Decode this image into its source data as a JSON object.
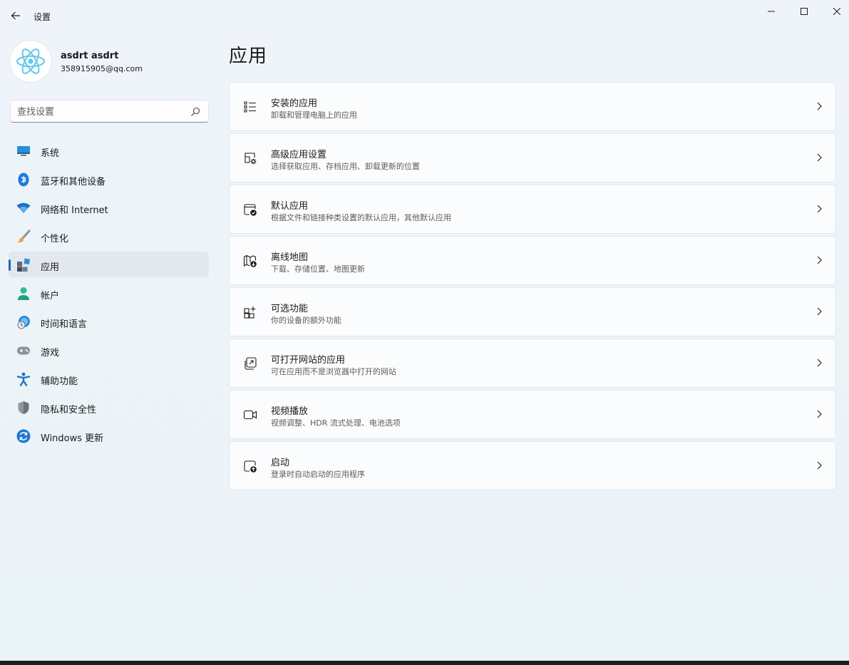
{
  "window": {
    "title": "设置"
  },
  "user": {
    "name": "asdrt asdrt",
    "email": "358915905@qq.com"
  },
  "search": {
    "placeholder": "查找设置"
  },
  "sidebar": {
    "items": [
      {
        "label": "系统",
        "icon": "display-icon",
        "active": false
      },
      {
        "label": "蓝牙和其他设备",
        "icon": "bluetooth-icon",
        "active": false
      },
      {
        "label": "网络和 Internet",
        "icon": "wifi-icon",
        "active": false
      },
      {
        "label": "个性化",
        "icon": "brush-icon",
        "active": false
      },
      {
        "label": "应用",
        "icon": "apps-icon",
        "active": true
      },
      {
        "label": "帐户",
        "icon": "account-icon",
        "active": false
      },
      {
        "label": "时间和语言",
        "icon": "globe-clock-icon",
        "active": false
      },
      {
        "label": "游戏",
        "icon": "gamepad-icon",
        "active": false
      },
      {
        "label": "辅助功能",
        "icon": "accessibility-icon",
        "active": false
      },
      {
        "label": "隐私和安全性",
        "icon": "shield-icon",
        "active": false
      },
      {
        "label": "Windows 更新",
        "icon": "update-icon",
        "active": false
      }
    ]
  },
  "main": {
    "title": "应用",
    "cards": [
      {
        "title": "安装的应用",
        "subtitle": "卸载和管理电脑上的应用",
        "icon": "list-icon"
      },
      {
        "title": "高级应用设置",
        "subtitle": "选择获取应用、存档应用、卸载更新的位置",
        "icon": "app-settings-icon"
      },
      {
        "title": "默认应用",
        "subtitle": "根据文件和链接种类设置的默认应用，其他默认应用",
        "icon": "default-app-icon"
      },
      {
        "title": "离线地图",
        "subtitle": "下载、存储位置、地图更新",
        "icon": "offline-map-icon"
      },
      {
        "title": "可选功能",
        "subtitle": "你的设备的额外功能",
        "icon": "optional-features-icon"
      },
      {
        "title": "可打开网站的应用",
        "subtitle": "可在应用而不是浏览器中打开的网站",
        "icon": "open-website-icon"
      },
      {
        "title": "视频播放",
        "subtitle": "视频调整、HDR 流式处理、电池选项",
        "icon": "video-icon"
      },
      {
        "title": "启动",
        "subtitle": "登录时自动启动的应用程序",
        "icon": "startup-icon"
      }
    ]
  },
  "colors": {
    "accent": "#1f66b8",
    "background": "#eef4f9",
    "card": "#fbfcfd"
  }
}
